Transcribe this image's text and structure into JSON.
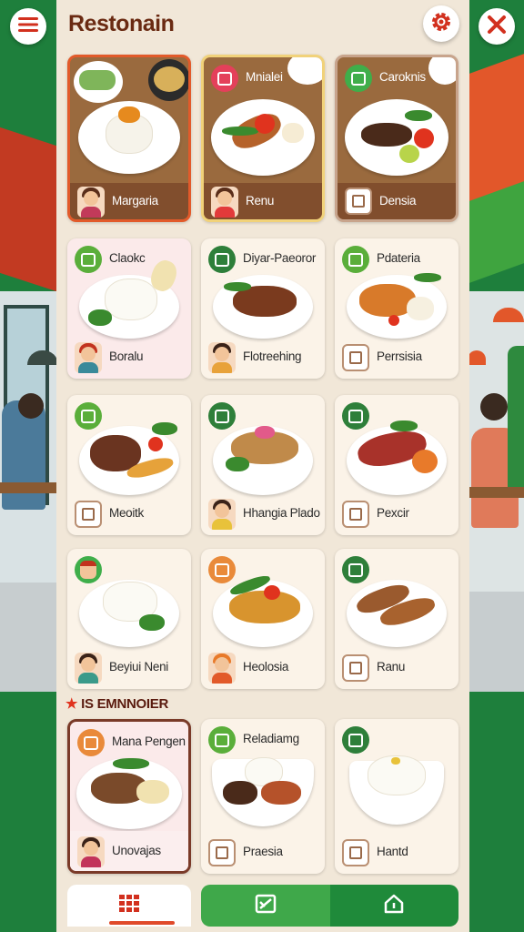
{
  "app": {
    "title": "Restonain"
  },
  "header": {
    "menu_icon": "hamburger-icon",
    "settings_icon": "gear-icon",
    "close_icon": "close-icon"
  },
  "colors": {
    "brand_red": "#e0331e",
    "green": "#2e9e46",
    "dark_green": "#1e7f3c",
    "orange": "#e98a3a",
    "title_brown": "#6a2a12"
  },
  "rows": [
    [
      {
        "name": "",
        "footer": "Margaria",
        "style": "wood",
        "footer_type": "avatar"
      },
      {
        "name": "Mnialei",
        "footer": "Renu",
        "style": "wood",
        "footer_type": "avatar"
      },
      {
        "name": "Caroknis",
        "footer": "Densia",
        "style": "wood",
        "footer_type": "tile"
      }
    ],
    [
      {
        "name": "Claokc",
        "footer": "Boralu",
        "style": "pink",
        "footer_type": "avatar"
      },
      {
        "name": "Diyar-Paeoror",
        "footer": "Flotreehing",
        "style": "plain",
        "footer_type": "avatar"
      },
      {
        "name": "Pdateria",
        "footer": "Perrsisia",
        "style": "plain",
        "footer_type": "tile"
      }
    ],
    [
      {
        "name": "",
        "footer": "Meoitk",
        "style": "plain",
        "footer_type": "tile"
      },
      {
        "name": "",
        "footer": "Hhangia Plado",
        "style": "plain",
        "footer_type": "avatar"
      },
      {
        "name": "",
        "footer": "Pexcir",
        "style": "plain",
        "footer_type": "tile"
      }
    ],
    [
      {
        "name": "",
        "footer": "Beyiui Neni",
        "style": "plain",
        "footer_type": "avatar"
      },
      {
        "name": "",
        "footer": "Heolosia",
        "style": "plain",
        "footer_type": "avatar"
      },
      {
        "name": "",
        "footer": "Ranu",
        "style": "plain",
        "footer_type": "tile"
      }
    ]
  ],
  "section": {
    "label": "IS EMNNOIER"
  },
  "featured": [
    {
      "name": "Mana Pengen",
      "footer": "Unovajas",
      "style": "pink",
      "footer_type": "avatar"
    },
    {
      "name": "Reladiamg",
      "footer": "Praesia",
      "style": "plain",
      "footer_type": "tile"
    },
    {
      "name": "",
      "footer": "Hantd",
      "style": "plain",
      "footer_type": "tile"
    }
  ],
  "nav": {
    "grid_icon": "grid-icon",
    "map_icon": "map-icon",
    "home_icon": "home-icon"
  }
}
